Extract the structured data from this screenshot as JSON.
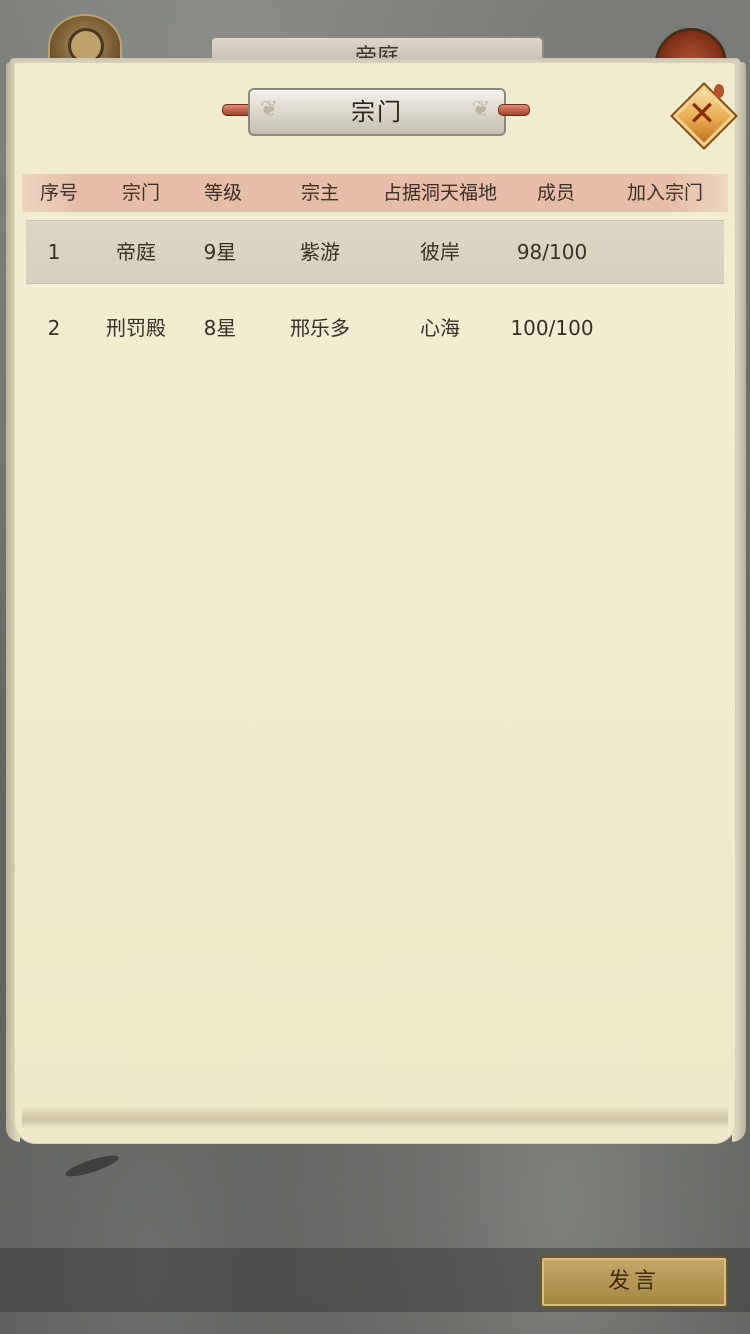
{
  "background": {
    "tab_title": "帝庭"
  },
  "dialog": {
    "title": "宗门",
    "close_icon": "close-x-icon"
  },
  "table": {
    "headers": [
      "序号",
      "宗门",
      "等级",
      "宗主",
      "占据洞天福地",
      "成员",
      "加入宗门"
    ],
    "rows": [
      {
        "index": "1",
        "sect": "帝庭",
        "level": "9星",
        "leader": "紫游",
        "territory": "彼岸",
        "members": "98/100",
        "join": ""
      },
      {
        "index": "2",
        "sect": "刑罚殿",
        "level": "8星",
        "leader": "邢乐多",
        "territory": "心海",
        "members": "100/100",
        "join": ""
      }
    ],
    "selected_row": 0
  },
  "chat": {
    "speak_label": "发言"
  },
  "colors": {
    "parchment": "#f1ebd0",
    "header_band": "#e6bda9",
    "selected_row": "#d9d3bf",
    "close_button": "#e8a94c",
    "speak_button": "#b39550"
  }
}
